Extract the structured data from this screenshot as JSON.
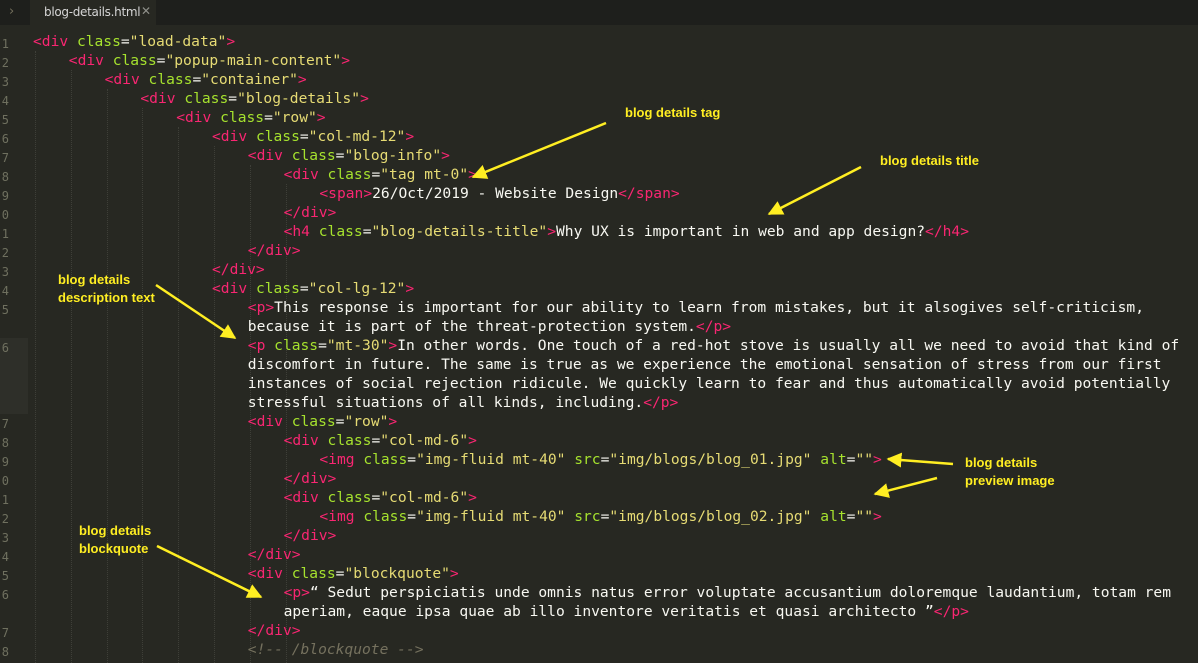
{
  "tab": {
    "filename": "blog-details.html",
    "close_glyph": "✕",
    "chevron_glyph": "›"
  },
  "gutter": [
    "1",
    "2",
    "3",
    "4",
    "5",
    "6",
    "7",
    "8",
    "9",
    "0",
    "1",
    "2",
    "3",
    "4",
    "5",
    "6",
    "7",
    "8",
    "9",
    "0",
    "1",
    "2",
    "3",
    "4",
    "5",
    "6",
    "7",
    "8"
  ],
  "code": [
    [
      [
        "tg",
        "<div "
      ],
      [
        "at",
        "class"
      ],
      [
        "tx",
        "="
      ],
      [
        "st",
        "\"load-data\""
      ],
      [
        "tg",
        ">"
      ]
    ],
    [
      [
        "tg",
        "<div "
      ],
      [
        "at",
        "class"
      ],
      [
        "tx",
        "="
      ],
      [
        "st",
        "\"popup-main-content\""
      ],
      [
        "tg",
        ">"
      ]
    ],
    [
      [
        "tg",
        "<div "
      ],
      [
        "at",
        "class"
      ],
      [
        "tx",
        "="
      ],
      [
        "st",
        "\"container\""
      ],
      [
        "tg",
        ">"
      ]
    ],
    [
      [
        "tg",
        "<div "
      ],
      [
        "at",
        "class"
      ],
      [
        "tx",
        "="
      ],
      [
        "st",
        "\"blog-details\""
      ],
      [
        "tg",
        ">"
      ]
    ],
    [
      [
        "tg",
        "<div "
      ],
      [
        "at",
        "class"
      ],
      [
        "tx",
        "="
      ],
      [
        "st",
        "\"row\""
      ],
      [
        "tg",
        ">"
      ]
    ],
    [
      [
        "tg",
        "<div "
      ],
      [
        "at",
        "class"
      ],
      [
        "tx",
        "="
      ],
      [
        "st",
        "\"col-md-12\""
      ],
      [
        "tg",
        ">"
      ]
    ],
    [
      [
        "tg",
        "<div "
      ],
      [
        "at",
        "class"
      ],
      [
        "tx",
        "="
      ],
      [
        "st",
        "\"blog-info\""
      ],
      [
        "tg",
        ">"
      ]
    ],
    [
      [
        "tg",
        "<div "
      ],
      [
        "at",
        "class"
      ],
      [
        "tx",
        "="
      ],
      [
        "st",
        "\"tag mt-0\""
      ],
      [
        "tg",
        ">"
      ]
    ],
    [
      [
        "tg",
        "<span"
      ],
      [
        "tg",
        ">"
      ],
      [
        "tx",
        "26/Oct/2019 - Website Design"
      ],
      [
        "tg",
        "</span>"
      ]
    ],
    [
      [
        "tg",
        "</div>"
      ]
    ],
    [
      [
        "tg",
        "<h4 "
      ],
      [
        "at",
        "class"
      ],
      [
        "tx",
        "="
      ],
      [
        "st",
        "\"blog-details-title\""
      ],
      [
        "tg",
        ">"
      ],
      [
        "tx",
        "Why UX is important in web and app design?"
      ],
      [
        "tg",
        "</h4>"
      ]
    ],
    [
      [
        "tg",
        "</div>"
      ]
    ],
    [
      [
        "tg",
        "</div>"
      ]
    ],
    [
      [
        "tg",
        "<div "
      ],
      [
        "at",
        "class"
      ],
      [
        "tx",
        "="
      ],
      [
        "st",
        "\"col-lg-12\""
      ],
      [
        "tg",
        ">"
      ]
    ],
    [
      [
        "tg",
        "<p>"
      ],
      [
        "tx",
        "This response is important for our ability to learn from mistakes, but it alsogives self-criticism,"
      ]
    ],
    [
      [
        "tx",
        "because it is part of the threat-protection system."
      ],
      [
        "tg",
        "</p>"
      ]
    ],
    [
      [
        "tg",
        "<p "
      ],
      [
        "at",
        "class"
      ],
      [
        "tx",
        "="
      ],
      [
        "st",
        "\"mt-30\""
      ],
      [
        "tg",
        ">"
      ],
      [
        "tx",
        "In other words. One touch of a red-hot stove is usually all we need to avoid that kind of"
      ]
    ],
    [
      [
        "tx",
        "discomfort in future. The same is true as we experience the emotional sensation of stress from our first"
      ]
    ],
    [
      [
        "tx",
        "instances of social rejection ridicule. We quickly learn to fear and thus automatically avoid potentially"
      ]
    ],
    [
      [
        "tx",
        "stressful situations of all kinds, including."
      ],
      [
        "tg",
        "</p>"
      ]
    ],
    [
      [
        "tg",
        "<div "
      ],
      [
        "at",
        "class"
      ],
      [
        "tx",
        "="
      ],
      [
        "st",
        "\"row\""
      ],
      [
        "tg",
        ">"
      ]
    ],
    [
      [
        "tg",
        "<div "
      ],
      [
        "at",
        "class"
      ],
      [
        "tx",
        "="
      ],
      [
        "st",
        "\"col-md-6\""
      ],
      [
        "tg",
        ">"
      ]
    ],
    [
      [
        "tg",
        "<img "
      ],
      [
        "at",
        "class"
      ],
      [
        "tx",
        "="
      ],
      [
        "st",
        "\"img-fluid mt-40\""
      ],
      [
        "tx",
        " "
      ],
      [
        "at",
        "src"
      ],
      [
        "tx",
        "="
      ],
      [
        "st",
        "\"img/blogs/blog_01.jpg\""
      ],
      [
        "tx",
        " "
      ],
      [
        "at",
        "alt"
      ],
      [
        "tx",
        "="
      ],
      [
        "st",
        "\"\""
      ],
      [
        "tg",
        ">"
      ]
    ],
    [
      [
        "tg",
        "</div>"
      ]
    ],
    [
      [
        "tg",
        "<div "
      ],
      [
        "at",
        "class"
      ],
      [
        "tx",
        "="
      ],
      [
        "st",
        "\"col-md-6\""
      ],
      [
        "tg",
        ">"
      ]
    ],
    [
      [
        "tg",
        "<img "
      ],
      [
        "at",
        "class"
      ],
      [
        "tx",
        "="
      ],
      [
        "st",
        "\"img-fluid mt-40\""
      ],
      [
        "tx",
        " "
      ],
      [
        "at",
        "src"
      ],
      [
        "tx",
        "="
      ],
      [
        "st",
        "\"img/blogs/blog_02.jpg\""
      ],
      [
        "tx",
        " "
      ],
      [
        "at",
        "alt"
      ],
      [
        "tx",
        "="
      ],
      [
        "st",
        "\"\""
      ],
      [
        "tg",
        ">"
      ]
    ],
    [
      [
        "tg",
        "</div>"
      ]
    ],
    [
      [
        "tg",
        "</div>"
      ]
    ],
    [
      [
        "tg",
        "<div "
      ],
      [
        "at",
        "class"
      ],
      [
        "tx",
        "="
      ],
      [
        "st",
        "\"blockquote\""
      ],
      [
        "tg",
        ">"
      ]
    ],
    [
      [
        "tg",
        "<p>"
      ],
      [
        "tx",
        "“ Sedut perspiciatis unde omnis natus error voluptate accusantium doloremque laudantium, totam rem"
      ]
    ],
    [
      [
        "tx",
        "aperiam, eaque ipsa quae ab illo inventore veritatis et quasi architecto ”"
      ],
      [
        "tg",
        "</p>"
      ]
    ],
    [
      [
        "tg",
        "</div>"
      ]
    ],
    [
      [
        "cm",
        "<!-- /blockquote -->"
      ]
    ]
  ],
  "annotations": {
    "tag": "blog details tag",
    "title": "blog details title",
    "description": [
      "blog details",
      "description text"
    ],
    "preview_image": [
      "blog details",
      "preview image"
    ],
    "blockquote": [
      "blog details",
      "blockquote"
    ]
  },
  "colors": {
    "background": "#272822",
    "tag": "#f92672",
    "attribute": "#a6e22e",
    "string": "#e6db74",
    "text": "#f8f8f2",
    "comment": "#75715e",
    "annotation": "#ffee22"
  }
}
